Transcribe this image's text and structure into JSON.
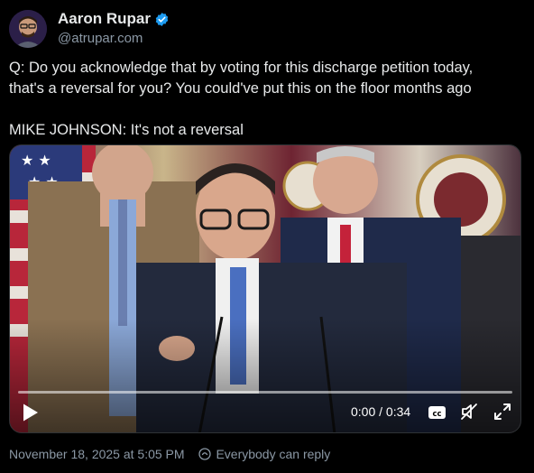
{
  "author": {
    "display_name": "Aaron Rupar",
    "handle": "@atrupar.com",
    "verified": true
  },
  "tweet": {
    "lines": [
      "Q: Do you acknowledge that by voting for this discharge petition today,",
      "that's a reversal for you? You could've put this on the floor months ago",
      "MIKE JOHNSON: It's not a reversal"
    ]
  },
  "video": {
    "current_time": "0:00",
    "separator": " / ",
    "duration": "0:34",
    "progress": 0.0,
    "cc_label": "cc",
    "muted": true
  },
  "footer": {
    "timestamp": "November 18, 2025 at 5:05 PM",
    "reply_setting": "Everybody can reply"
  },
  "colors": {
    "background": "#000000",
    "text_primary": "#e7e9ea",
    "text_secondary": "#8b98a5",
    "verified": "#1d9bf0"
  },
  "icons": {
    "verified": "verified-badge-icon",
    "play": "play-icon",
    "cc": "closed-captions-icon",
    "mute": "muted-speaker-icon",
    "fullscreen": "fullscreen-icon",
    "reply": "reply-permission-icon"
  }
}
